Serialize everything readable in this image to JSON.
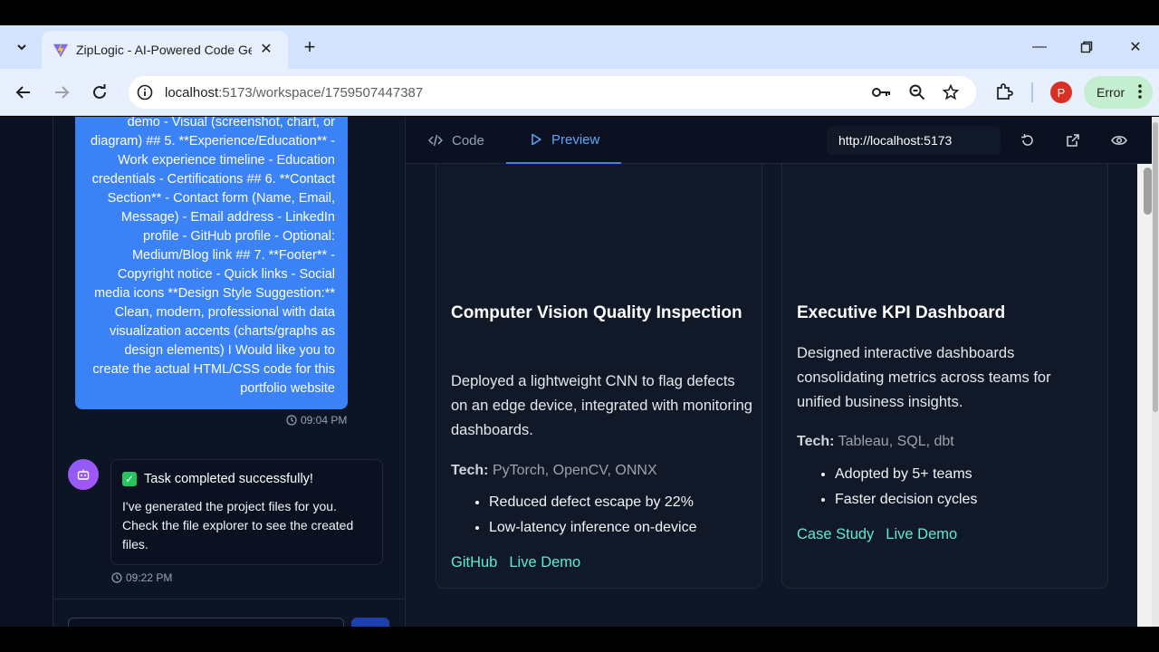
{
  "browser": {
    "tab_title": "ZipLogic - AI-Powered Code Ge",
    "url_host": "localhost",
    "url_rest": ":5173/workspace/1759507447387",
    "profile_initial": "P",
    "error_label": "Error"
  },
  "chat": {
    "user_message": "demo   - Visual (screenshot, chart, or diagram)  ## 5. **Experience/Education** - Work experience timeline - Education credentials - Certifications  ## 6. **Contact Section** - Contact form (Name, Email, Message) - Email address - LinkedIn profile - GitHub profile - Optional: Medium/Blog link  ## 7. **Footer** - Copyright notice - Quick links - Social media icons  **Design Style Suggestion:** Clean, modern, professional with data visualization accents (charts/graphs as design elements)  I Would  like you to create the actual HTML/CSS code for this portfolio website",
    "user_time": "09:04 PM",
    "bot_status": "Task completed successfully!",
    "bot_message": "I've generated the project files for you. Check the file explorer to see the created files.",
    "bot_time": "09:22 PM"
  },
  "panel": {
    "tab_code": "Code",
    "tab_preview": "Preview",
    "preview_url": "http://localhost:5173"
  },
  "cards": [
    {
      "title": "Computer Vision Quality Inspection",
      "desc": "Deployed a lightweight CNN to flag defects on an edge device, integrated with monitoring dashboards.",
      "tech_label": "Tech:",
      "tech": "PyTorch, OpenCV, ONNX",
      "bullets": [
        "Reduced defect escape by 22%",
        "Low-latency inference on-device"
      ],
      "link1": "GitHub",
      "link2": "Live Demo"
    },
    {
      "title": "Executive KPI Dashboard",
      "desc": "Designed interactive dashboards consolidating metrics across teams for unified business insights.",
      "tech_label": "Tech:",
      "tech": "Tableau, SQL, dbt",
      "bullets": [
        "Adopted by 5+ teams",
        "Faster decision cycles"
      ],
      "link1": "Case Study",
      "link2": "Live Demo"
    }
  ]
}
